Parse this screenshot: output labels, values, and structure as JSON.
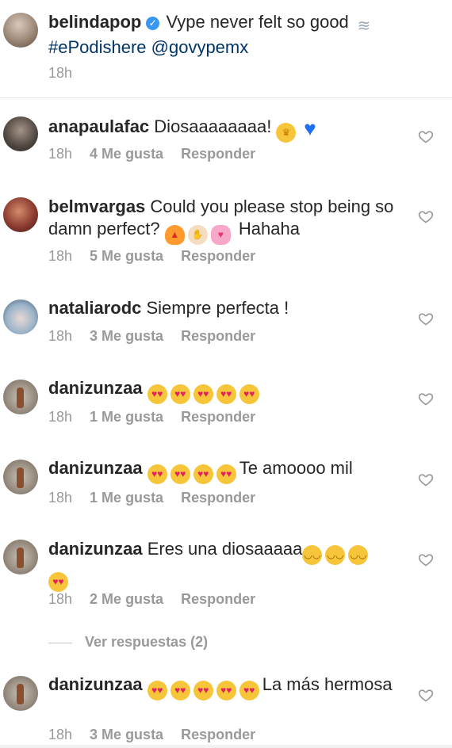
{
  "caption": {
    "username": "belindapop",
    "text": "Vype never felt so good",
    "hashtags": "#ePodishere @govypemx",
    "time": "18h",
    "emoji": "wind-face-emoji"
  },
  "comments": [
    {
      "username": "anapaulafac",
      "text": "Diosaaaaaaaa!",
      "emojis": [
        "crown-woman-emoji",
        "blue-heart-emoji"
      ],
      "time": "18h",
      "likes": "4 Me gusta",
      "reply": "Responder"
    },
    {
      "username": "belmvargas",
      "text": "Could you please stop being so damn perfect?",
      "emojis": [
        "fire-emoji",
        "raising-hands-emoji",
        "two-hearts-emoji"
      ],
      "tail": "Hahaha",
      "time": "18h",
      "likes": "5 Me gusta",
      "reply": "Responder"
    },
    {
      "username": "nataliarodc",
      "text": "Siempre perfecta !",
      "time": "18h",
      "likes": "3 Me gusta",
      "reply": "Responder"
    },
    {
      "username": "danizunzaa",
      "emojis": [
        "heart-eyes-emoji",
        "heart-eyes-emoji",
        "heart-eyes-emoji",
        "heart-eyes-emoji",
        "heart-eyes-emoji"
      ],
      "time": "18h",
      "likes": "1 Me gusta",
      "reply": "Responder"
    },
    {
      "username": "danizunzaa",
      "emojis": [
        "heart-eyes-emoji",
        "heart-eyes-emoji",
        "heart-eyes-emoji",
        "heart-eyes-emoji"
      ],
      "text": "Te amoooo mil",
      "time": "18h",
      "likes": "1 Me gusta",
      "reply": "Responder"
    },
    {
      "username": "danizunzaa",
      "text": "Eres una diosaaaaa",
      "emojis": [
        "relieved-emoji",
        "drooling-emoji",
        "relieved-emoji",
        "heart-eyes-emoji"
      ],
      "time": "18h",
      "likes": "2 Me gusta",
      "reply": "Responder"
    },
    {
      "username": "danizunzaa",
      "emojis": [
        "heart-eyes-emoji",
        "heart-eyes-emoji",
        "heart-eyes-emoji",
        "heart-eyes-emoji",
        "heart-eyes-emoji"
      ],
      "text": "La más hermosa",
      "time": "18h",
      "likes": "3 Me gusta",
      "reply": "Responder"
    }
  ],
  "view_replies": "Ver respuestas (2)",
  "colors": {
    "text": "#262626",
    "meta": "#999999",
    "link": "#003569",
    "verified": "#3897f0"
  }
}
